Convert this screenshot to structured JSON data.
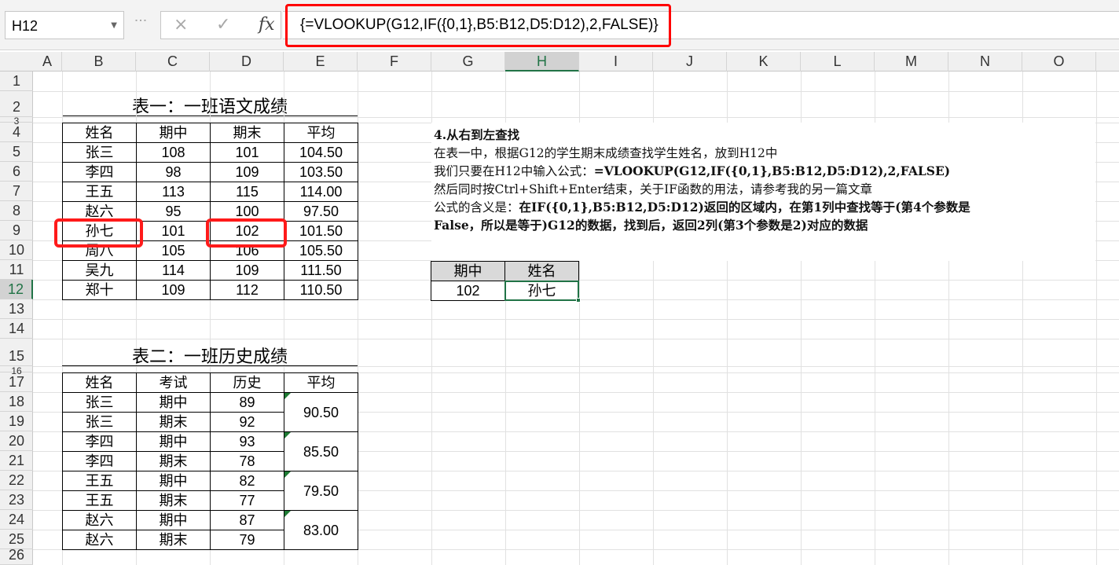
{
  "name_box": "H12",
  "formula_bar": {
    "cancel_icon": "×",
    "enter_icon": "✓",
    "fx_label": "fx",
    "formula": "{=VLOOKUP(G12,IF({0,1},B5:B12,D5:D12),2,FALSE)}"
  },
  "columns": [
    "A",
    "B",
    "C",
    "D",
    "E",
    "F",
    "G",
    "H",
    "I",
    "J",
    "K",
    "L",
    "M",
    "N",
    "O"
  ],
  "rows": [
    "1",
    "2",
    "3",
    "4",
    "5",
    "6",
    "7",
    "8",
    "9",
    "10",
    "11",
    "12",
    "13",
    "14",
    "15",
    "16",
    "17",
    "18",
    "19",
    "20",
    "21",
    "22",
    "23",
    "24",
    "25",
    "26"
  ],
  "table1": {
    "title": "表一：一班语文成绩",
    "headers": [
      "姓名",
      "期中",
      "期末",
      "平均"
    ],
    "rows": [
      [
        "张三",
        "108",
        "101",
        "104.50"
      ],
      [
        "李四",
        "98",
        "109",
        "103.50"
      ],
      [
        "王五",
        "113",
        "115",
        "114.00"
      ],
      [
        "赵六",
        "95",
        "100",
        "97.50"
      ],
      [
        "孙七",
        "101",
        "102",
        "101.50"
      ],
      [
        "周八",
        "105",
        "106",
        "105.50"
      ],
      [
        "吴九",
        "114",
        "109",
        "111.50"
      ],
      [
        "郑十",
        "109",
        "112",
        "110.50"
      ]
    ]
  },
  "table2": {
    "title": "表二：一班历史成绩",
    "headers": [
      "姓名",
      "考试",
      "历史",
      "平均"
    ],
    "rows": [
      [
        "张三",
        "期中",
        "89"
      ],
      [
        "张三",
        "期末",
        "92"
      ],
      [
        "李四",
        "期中",
        "93"
      ],
      [
        "李四",
        "期末",
        "78"
      ],
      [
        "王五",
        "期中",
        "82"
      ],
      [
        "王五",
        "期末",
        "77"
      ],
      [
        "赵六",
        "期中",
        "87"
      ],
      [
        "赵六",
        "期末",
        "79"
      ]
    ],
    "averages": [
      "90.50",
      "85.50",
      "79.50",
      "83.00"
    ]
  },
  "note": {
    "line1": "4.从右到左查找",
    "line2": "在表一中，根据G12的学生期末成绩查找学生姓名，放到H12中",
    "line3a": "我们只要在H12中输入公式：",
    "line3b": "=VLOOKUP(G12,IF({0,1},B5:B12,D5:D12),2,FALSE)",
    "line4": "然后同时按Ctrl+Shift+Enter结束，关于IF函数的用法，请参考我的另一篇文章",
    "line5a": "公式的含义是：",
    "line5b": "在IF({0,1},B5:B12,D5:D12)返回的区域内，在第1列中查找等于(第4个参数是",
    "line6": "False，所以是等于)G12的数据，找到后，返回2列(第3个参数是2)对应的数据"
  },
  "lookup": {
    "header_g": "期中",
    "header_h": "姓名",
    "value_g": "102",
    "value_h": "孙七"
  },
  "colors": {
    "highlight": "#ff0000",
    "selection": "#217346",
    "comment_marker": "#1e7b34"
  }
}
